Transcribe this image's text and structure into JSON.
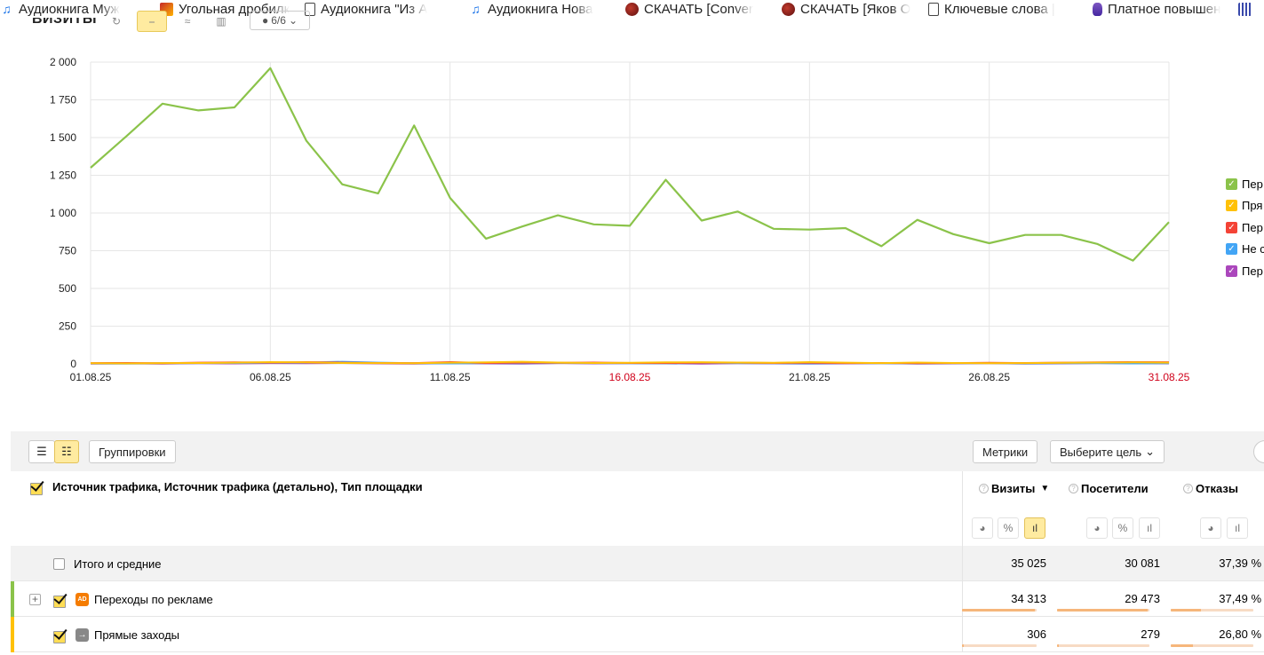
{
  "bookmarks": [
    {
      "label": "Аудиокнига Муж",
      "icon": "headphones-icon",
      "x": 0,
      "w": 175
    },
    {
      "label": "Угольная дробилк",
      "icon": "fire-icon",
      "x": 180,
      "w": 158
    },
    {
      "label": "Аудиокнига \"Из А",
      "icon": "document-icon",
      "x": 343,
      "w": 180
    },
    {
      "label": "Аудиокнига Нова",
      "icon": "headphones-icon",
      "x": 528,
      "w": 170
    },
    {
      "label": "СКАЧАТЬ [Conver",
      "icon": "round-logo-icon",
      "x": 704,
      "w": 170
    },
    {
      "label": "СКАЧАТЬ [Яков О",
      "icon": "round-logo-icon",
      "x": 880,
      "w": 160
    },
    {
      "label": "Ключевые слова |",
      "icon": "document-icon",
      "x": 1045,
      "w": 180
    },
    {
      "label": "Платное повышен",
      "icon": "hand-icon",
      "x": 1230,
      "w": 160
    },
    {
      "label": "",
      "icon": "calendar-icon",
      "x": 1394,
      "w": 29
    }
  ],
  "chart_toolbar": {
    "title": "ВИЗИТЫ",
    "select_label": "6/6"
  },
  "chart_data": {
    "type": "line",
    "x": [
      "01.08.25",
      "02.08.25",
      "03.08.25",
      "04.08.25",
      "05.08.25",
      "06.08.25",
      "07.08.25",
      "08.08.25",
      "09.08.25",
      "10.08.25",
      "11.08.25",
      "12.08.25",
      "13.08.25",
      "14.08.25",
      "15.08.25",
      "16.08.25",
      "17.08.25",
      "18.08.25",
      "19.08.25",
      "20.08.25",
      "21.08.25",
      "22.08.25",
      "23.08.25",
      "24.08.25",
      "25.08.25",
      "26.08.25",
      "27.08.25",
      "28.08.25",
      "29.08.25",
      "30.08.25",
      "31.08.25"
    ],
    "x_tick_labels": [
      "01.08.25",
      "06.08.25",
      "11.08.25",
      "16.08.25",
      "21.08.25",
      "26.08.25",
      "31.08.25"
    ],
    "weekend_ticks": [
      "16.08.25",
      "31.08.25"
    ],
    "ylim": [
      0,
      2000
    ],
    "y_ticks": [
      0,
      250,
      500,
      750,
      1000,
      1250,
      1500,
      1750,
      2000
    ],
    "y_tick_labels": [
      "0",
      "250",
      "500",
      "750",
      "1 000",
      "1 250",
      "1 500",
      "1 750",
      "2 000"
    ],
    "grid": true,
    "series": [
      {
        "color": "#8bc34a",
        "values": [
          1300,
          1510,
          1725,
          1680,
          1700,
          1960,
          1480,
          1190,
          1130,
          1580,
          1100,
          830,
          910,
          985,
          925,
          915,
          1220,
          950,
          1010,
          895,
          890,
          900,
          780,
          955,
          860,
          800,
          855,
          855,
          795,
          685,
          940
        ]
      },
      {
        "color": "#ffc107",
        "values": [
          4,
          3,
          5,
          6,
          8,
          12,
          10,
          6,
          5,
          4,
          8,
          10,
          14,
          9,
          6,
          7,
          10,
          11,
          9,
          7,
          12,
          8,
          5,
          9,
          6,
          4,
          5,
          7,
          9,
          10,
          8
        ]
      },
      {
        "color": "#f44336",
        "values": [
          5,
          6,
          4,
          8,
          10,
          9,
          12,
          8,
          6,
          5,
          12,
          6,
          8,
          7,
          9,
          6,
          5,
          7,
          8,
          6,
          7,
          5,
          6,
          4,
          5,
          7,
          6,
          8,
          10,
          12,
          11
        ]
      },
      {
        "color": "#42a5f5",
        "values": [
          3,
          2,
          4,
          5,
          6,
          7,
          9,
          14,
          8,
          4,
          3,
          5,
          4,
          6,
          5,
          4,
          3,
          6,
          5,
          4,
          3,
          5,
          4,
          3,
          4,
          5,
          3,
          4,
          5,
          3,
          4
        ]
      },
      {
        "color": "#ab47bc",
        "values": [
          2,
          3,
          2,
          4,
          3,
          5,
          4,
          6,
          3,
          2,
          4,
          3,
          2,
          5,
          3,
          4,
          3,
          2,
          4,
          3,
          2,
          3,
          4,
          2,
          3,
          4,
          2,
          3,
          5,
          4,
          3
        ]
      }
    ]
  },
  "legend": [
    {
      "label": "Пер",
      "color": "#8bc34a"
    },
    {
      "label": "Пря",
      "color": "#ffc107"
    },
    {
      "label": "Пер",
      "color": "#f44336"
    },
    {
      "label": "Не с",
      "color": "#42a5f5"
    },
    {
      "label": "Пер",
      "color": "#ab47bc"
    }
  ],
  "table_toolbar": {
    "groupings_label": "Группировки",
    "metrics_label": "Метрики",
    "goal_label": "Выберите цель"
  },
  "table": {
    "dimensions_header": "Источник трафика, Источник трафика (детально), Тип площадки",
    "metric_headers": [
      {
        "label": "Визиты",
        "sort": "▼"
      },
      {
        "label": "Посетители",
        "sort": ""
      },
      {
        "label": "Отказы",
        "sort": ""
      }
    ],
    "total": {
      "label": "Итого и средние",
      "values": [
        "35 025",
        "30 081",
        "37,39 %"
      ]
    },
    "rows": [
      {
        "label": "Переходы по рекламе",
        "badge": "AD",
        "color": "#8bc34a",
        "values": [
          "34 313",
          "29 473",
          "37,49 %"
        ],
        "shares": [
          0.98,
          0.98,
          0.37
        ]
      },
      {
        "label": "Прямые заходы",
        "badge": "→",
        "color": "#ffc107",
        "values": [
          "306",
          "279",
          "26,80 %"
        ],
        "shares": [
          0.01,
          0.01,
          0.27
        ]
      }
    ]
  }
}
